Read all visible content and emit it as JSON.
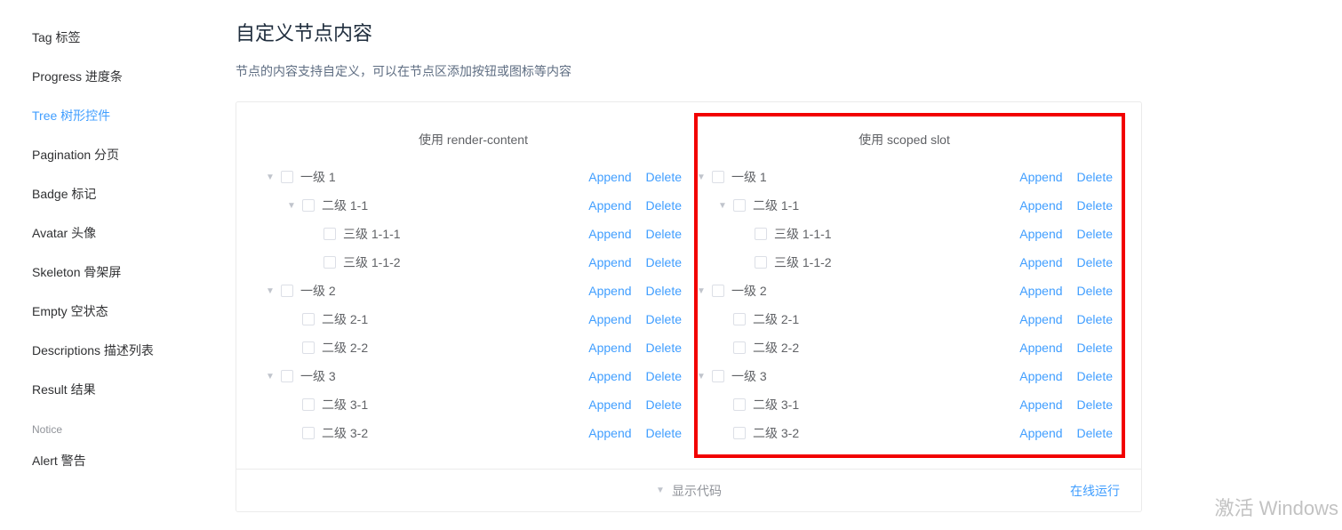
{
  "sidebar": {
    "items": [
      {
        "label": "Tag 标签",
        "active": false
      },
      {
        "label": "Progress 进度条",
        "active": false
      },
      {
        "label": "Tree 树形控件",
        "active": true
      },
      {
        "label": "Pagination 分页",
        "active": false
      },
      {
        "label": "Badge 标记",
        "active": false
      },
      {
        "label": "Avatar 头像",
        "active": false
      },
      {
        "label": "Skeleton 骨架屏",
        "active": false
      },
      {
        "label": "Empty 空状态",
        "active": false
      },
      {
        "label": "Descriptions 描述列表",
        "active": false
      },
      {
        "label": "Result 结果",
        "active": false
      }
    ],
    "group_title": "Notice",
    "group_items": [
      {
        "label": "Alert 警告",
        "active": false
      }
    ]
  },
  "section": {
    "title": "自定义节点内容",
    "desc": "节点的内容支持自定义，可以在节点区添加按钮或图标等内容"
  },
  "blocks": [
    {
      "title": "使用 render-content",
      "highlighted": false
    },
    {
      "title": "使用 scoped slot",
      "highlighted": true
    }
  ],
  "actions": {
    "append": "Append",
    "delete": "Delete"
  },
  "tree": [
    {
      "label": "一级 1",
      "level": 0,
      "expanded": true
    },
    {
      "label": "二级 1-1",
      "level": 1,
      "expanded": true
    },
    {
      "label": "三级 1-1-1",
      "level": 2,
      "expanded": false,
      "leaf": true
    },
    {
      "label": "三级 1-1-2",
      "level": 2,
      "expanded": false,
      "leaf": true
    },
    {
      "label": "一级 2",
      "level": 0,
      "expanded": true
    },
    {
      "label": "二级 2-1",
      "level": 1,
      "expanded": false,
      "leaf": true
    },
    {
      "label": "二级 2-2",
      "level": 1,
      "expanded": false,
      "leaf": true
    },
    {
      "label": "一级 3",
      "level": 0,
      "expanded": true
    },
    {
      "label": "二级 3-1",
      "level": 1,
      "expanded": false,
      "leaf": true
    },
    {
      "label": "二级 3-2",
      "level": 1,
      "expanded": false,
      "leaf": true
    }
  ],
  "footer": {
    "toggle": "显示代码",
    "online": "在线运行"
  },
  "watermark": "激活 Windows"
}
